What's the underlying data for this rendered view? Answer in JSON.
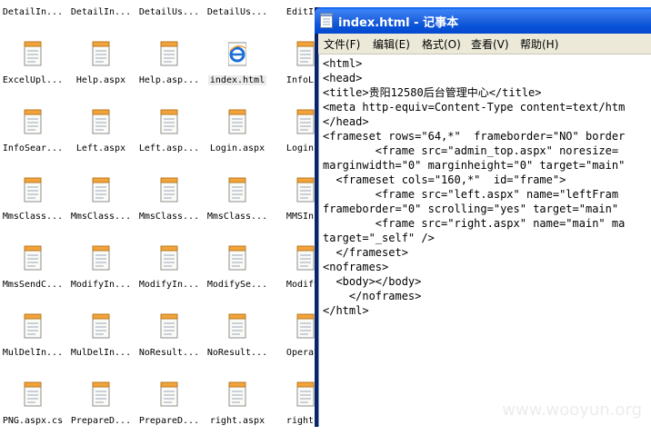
{
  "explorer": {
    "files": [
      "DetailIn...",
      "DetailIn...",
      "DetailUs...",
      "DetailUs...",
      "EditInf",
      "ExcelUpl...",
      "Help.aspx",
      "Help.asp...",
      "index.html",
      "InfoLis",
      "InfoSear...",
      "Left.aspx",
      "Left.asp...",
      "Login.aspx",
      "Login.a",
      "MmsClass...",
      "MmsClass...",
      "MmsClass...",
      "MmsClass...",
      "MMSInfo",
      "MmsSendC...",
      "ModifyIn...",
      "ModifyIn...",
      "ModifySe...",
      "ModifyS",
      "MulDelIn...",
      "MulDelIn...",
      "NoResult...",
      "NoResult...",
      "Operato",
      "PNG.aspx.cs",
      "PrepareD...",
      "PrepareD...",
      "right.aspx",
      "right.a"
    ]
  },
  "notepad": {
    "title": "index.html - 记事本",
    "menu": [
      "文件(F)",
      "编辑(E)",
      "格式(O)",
      "查看(V)",
      "帮助(H)"
    ],
    "content": "<html>\n<head>\n<title>贵阳12580后台管理中心</title>\n<meta http-equiv=Content-Type content=text/htm\n</head>\n<frameset rows=\"64,*\"  frameborder=\"NO\" border\n        <frame src=\"admin_top.aspx\" noresize=\nmarginwidth=\"0\" marginheight=\"0\" target=\"main\"\n  <frameset cols=\"160,*\"  id=\"frame\">\n        <frame src=\"left.aspx\" name=\"leftFram\nframeborder=\"0\" scrolling=\"yes\" target=\"main\"\n        <frame src=\"right.aspx\" name=\"main\" ma\ntarget=\"_self\" />\n  </frameset>\n<noframes>\n  <body></body>\n    </noframes>\n</html>"
  },
  "watermark": "www.wooyun.org",
  "colors": {
    "titlebar": "#0a54d8",
    "menubar": "#ece9d8",
    "icon_accent": "#f2a33a",
    "ie_blue": "#1a6fd6"
  }
}
